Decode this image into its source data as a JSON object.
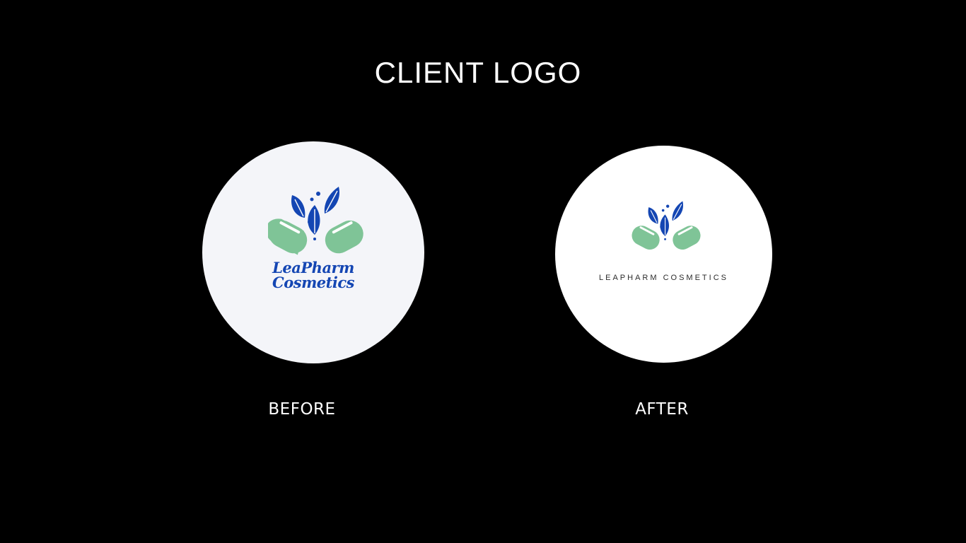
{
  "title": "CLIENT LOGO",
  "before": {
    "caption": "BEFORE",
    "wordmark_line1": "LeaPharm",
    "wordmark_line2": "Cosmetics",
    "circle_color": "#f4f5f9"
  },
  "after": {
    "caption": "AFTER",
    "wordmark": "LEAPHARM COSMETICS",
    "circle_color": "#ffffff"
  },
  "colors": {
    "background": "#000000",
    "capsule_green": "#7fc497",
    "leaf_blue": "#1446b3",
    "text_white": "#ffffff"
  },
  "icons": [
    "capsule-leaves-logo-icon"
  ]
}
